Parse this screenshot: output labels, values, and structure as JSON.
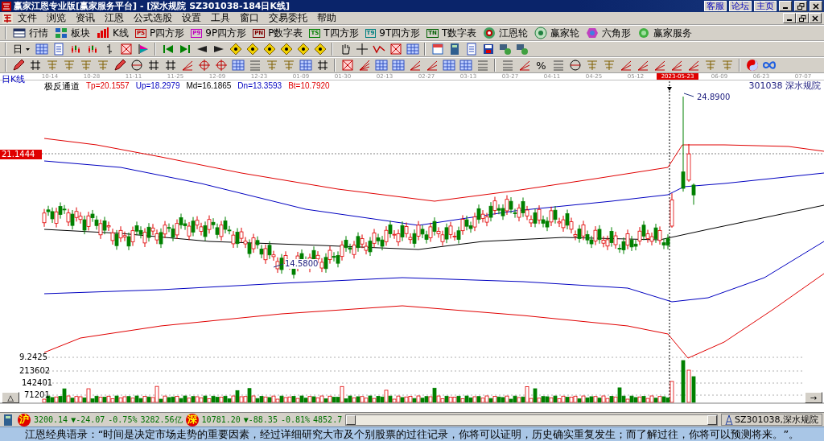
{
  "window": {
    "title": "赢家江恩专业版[赢家服务平台] - [深水规院   SZ301038-184日K线]",
    "links": [
      "客服",
      "论坛",
      "主页"
    ]
  },
  "menu": [
    "文件",
    "浏览",
    "资讯",
    "江恩",
    "公式选股",
    "设置",
    "工具",
    "窗口",
    "交易委托",
    "帮助"
  ],
  "toolbar": [
    {
      "label": "行情",
      "kind": "icon"
    },
    {
      "label": "板块",
      "kind": "icon"
    },
    {
      "label": "K线",
      "kind": "icon"
    },
    {
      "label": "P四方形",
      "kind": "tag",
      "tag": "PS",
      "color": "#c00000"
    },
    {
      "label": "9P四方形",
      "kind": "tag",
      "tag": "P9",
      "color": "#c000c0"
    },
    {
      "label": "P数字表",
      "kind": "tag",
      "tag": "PN",
      "color": "#800000"
    },
    {
      "label": "T四方形",
      "kind": "tag",
      "tag": "TS",
      "color": "#008000"
    },
    {
      "label": "9T四方形",
      "kind": "tag",
      "tag": "T9",
      "color": "#008080"
    },
    {
      "label": "T数字表",
      "kind": "tag",
      "tag": "TN",
      "color": "#006000"
    },
    {
      "label": "江恩轮",
      "kind": "icon"
    },
    {
      "label": "赢家轮",
      "kind": "icon"
    },
    {
      "label": "六角形",
      "kind": "icon"
    },
    {
      "label": "赢家服务",
      "kind": "icon"
    }
  ],
  "period_selector": "日",
  "percent_tool": "%",
  "chart": {
    "period": "日K线",
    "dates": [
      {
        "label": "10-14",
        "selected": false
      },
      {
        "label": "10-28",
        "selected": false
      },
      {
        "label": "11-11",
        "selected": false
      },
      {
        "label": "11-25",
        "selected": false
      },
      {
        "label": "12-09",
        "selected": false
      },
      {
        "label": "12-23",
        "selected": false
      },
      {
        "label": "01-09",
        "selected": false
      },
      {
        "label": "01-30",
        "selected": false
      },
      {
        "label": "02-13",
        "selected": false
      },
      {
        "label": "02-27",
        "selected": false
      },
      {
        "label": "03-13",
        "selected": false
      },
      {
        "label": "03-27",
        "selected": false
      },
      {
        "label": "04-11",
        "selected": false
      },
      {
        "label": "04-25",
        "selected": false
      },
      {
        "label": "05-12",
        "selected": false
      },
      {
        "label": "2023-05-23",
        "selected": true
      },
      {
        "label": "06-09",
        "selected": false
      },
      {
        "label": "06-23",
        "selected": false
      },
      {
        "label": "07-07",
        "selected": false
      }
    ],
    "indicator": "极反通道",
    "indicator_values": [
      {
        "label": "Tp=20.1557",
        "color": "#e00000"
      },
      {
        "label": "Up=18.2979",
        "color": "#0000c0"
      },
      {
        "label": "Md=16.1865",
        "color": "#000000"
      },
      {
        "label": "Dn=13.3593",
        "color": "#0000c0"
      },
      {
        "label": "Bt=10.7920",
        "color": "#e00000"
      }
    ],
    "stock": "301038  深水规院",
    "price_marker": "21.1444",
    "high_label": "24.8900",
    "low_label": "14.5800",
    "price_axis_low": "9.2425",
    "volume_labels": [
      "213602",
      "142401",
      "71201"
    ],
    "collapse_button": "△",
    "scroll_button": "→"
  },
  "status": {
    "indices": [
      {
        "market": "沪",
        "value": "3200.14",
        "change": "▼-24.07",
        "percent": "-0.75%",
        "amount": "3282.56亿"
      },
      {
        "market": "深",
        "value": "10781.20",
        "change": "▼-88.35",
        "percent": "-0.81%",
        "amount": "4852.7"
      }
    ],
    "stock_tab": "SZ301038,深水规院"
  },
  "ticker": "江恩经典语录：“时间是决定市场走势的重要因素，经过详细研究大市及个别股票的过往记录，你将可以证明，历史确实重复发生；而了解过往，你将可以预测将来。”。"
}
